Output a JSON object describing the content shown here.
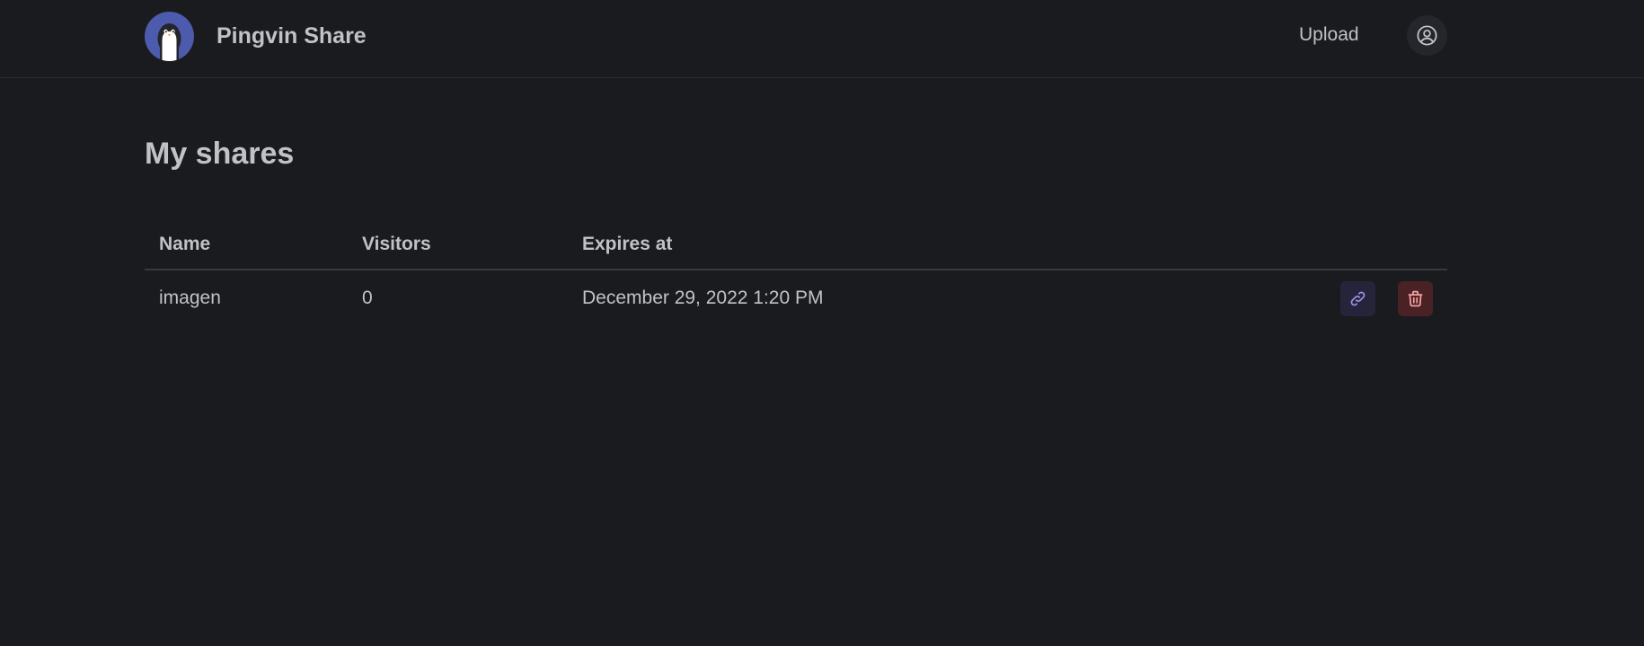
{
  "header": {
    "app_name": "Pingvin Share",
    "logo_icon": "penguin-logo",
    "nav_upload": "Upload",
    "avatar_icon": "user-circle-icon"
  },
  "main": {
    "title": "My shares",
    "table": {
      "columns": [
        "Name",
        "Visitors",
        "Expires at"
      ],
      "rows": [
        {
          "name": "imagen",
          "visitors": "0",
          "expires_at": "December 29, 2022 1:20 PM",
          "actions": [
            "link-icon",
            "trash-icon"
          ]
        }
      ]
    }
  },
  "colors": {
    "background": "#1a1b1e",
    "text": "#c1c2c5",
    "logo_bg": "#4c5bad",
    "link_button_bg": "#26243a",
    "link_icon": "#9b8ee6",
    "delete_button_bg": "#4a2225",
    "delete_icon": "#f4a0a0"
  }
}
